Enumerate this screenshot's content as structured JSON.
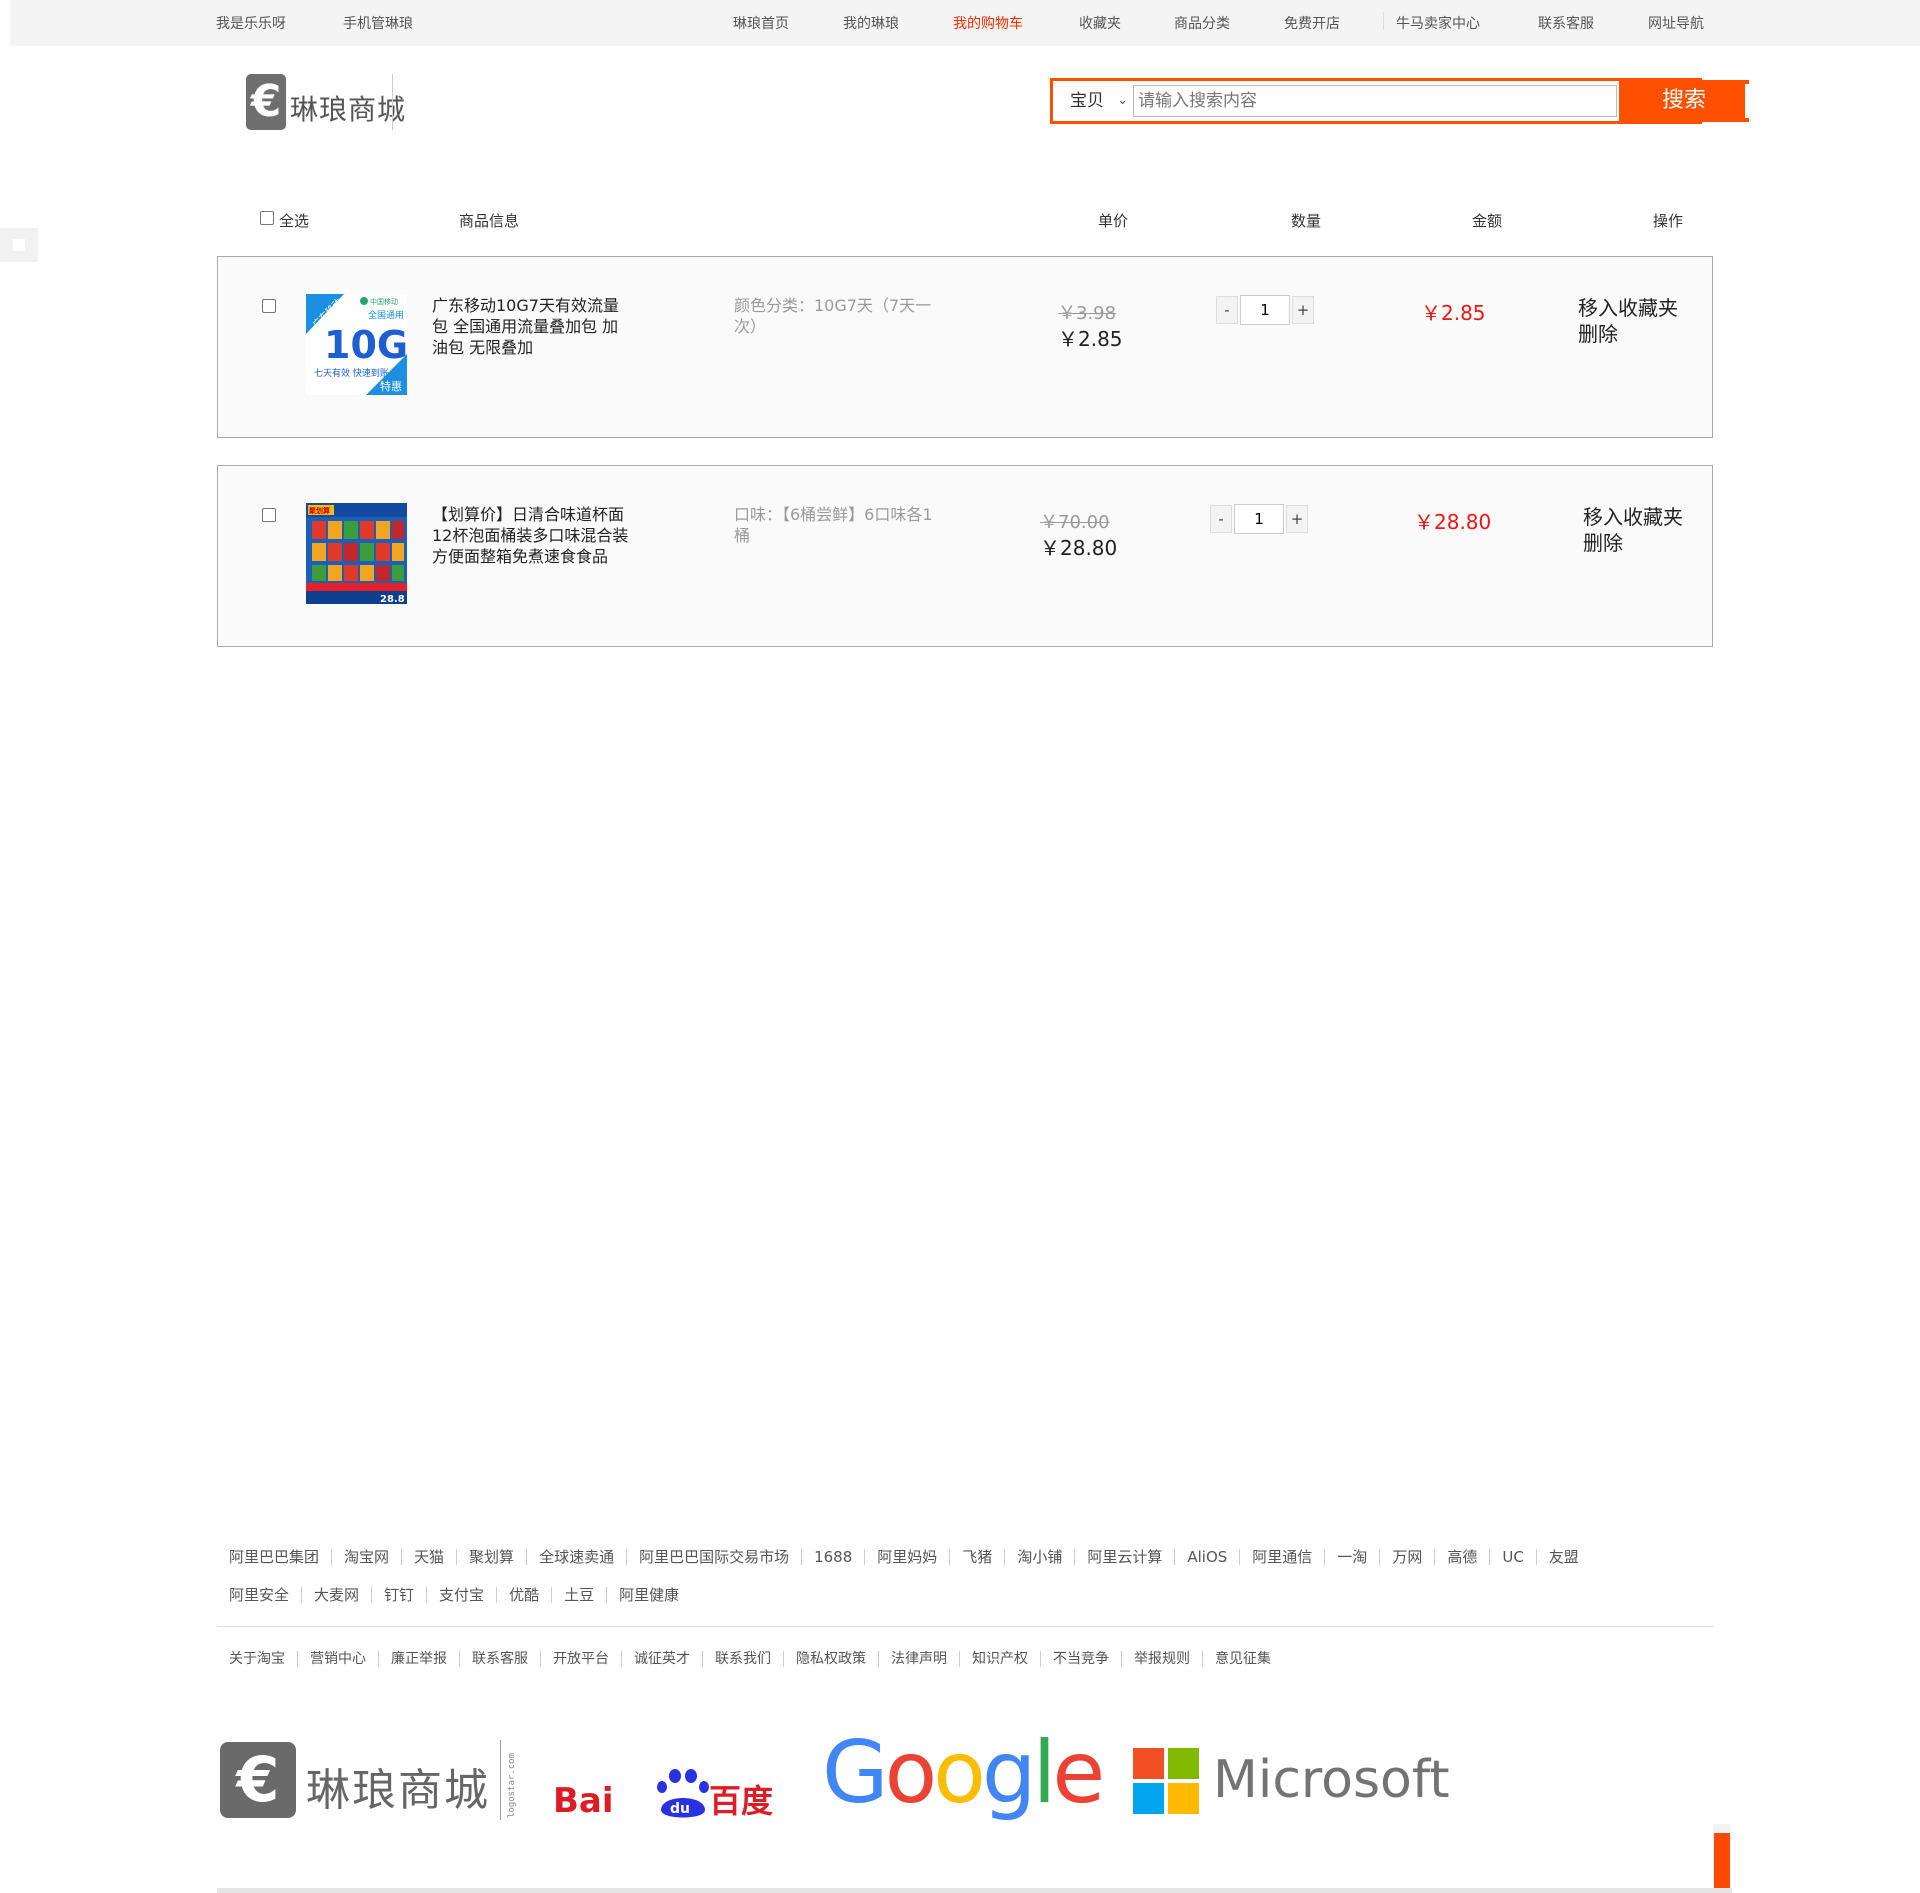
{
  "topnav": {
    "user": "我是乐乐呀",
    "mobile": "手机管琳琅",
    "items": [
      "琳琅首页",
      "我的琳琅",
      "我的购物车",
      "收藏夹",
      "商品分类",
      "免费开店",
      "牛马卖家中心",
      "联系客服",
      "网址导航"
    ],
    "active_index": 2,
    "active_color": "#f22e00"
  },
  "header": {
    "logo_symbol": "€",
    "logo_text": "琳琅商城",
    "search": {
      "category": "宝贝",
      "placeholder": "请输入搜索内容",
      "button": "搜索",
      "accent": "#ff5000"
    }
  },
  "cart": {
    "columns": {
      "select_all": "全选",
      "info": "商品信息",
      "price": "单价",
      "qty": "数量",
      "total": "金额",
      "ops": "操作"
    },
    "items": [
      {
        "title": "广东移动10G7天有效流量包 全国通用流量叠加包 加油包 无限叠加",
        "attr": "颜色分类：10G7天（7天一次）",
        "old_price": "￥3.98",
        "price": "￥2.85",
        "qty": "1",
        "total": "￥2.85",
        "op_fav": "移入收藏夹",
        "op_del": "删除",
        "thumb": {
          "corner": "广东移动",
          "brand": "中国移动",
          "sub": "全国通用",
          "big": "10G",
          "slogan": "七天有效 快速到账",
          "tag": "特惠"
        }
      },
      {
        "title": "【划算价】日清合味道杯面12杯泡面桶装多口味混合装方便面整箱免煮速食食品",
        "attr": "口味：【6桶尝鲜】6口味各1桶",
        "old_price": "￥70.00",
        "price": "￥28.80",
        "qty": "1",
        "total": "￥28.80",
        "op_fav": "移入收藏夹",
        "op_del": "删除",
        "thumb": {
          "badge": "聚划算",
          "price": "28.8"
        }
      }
    ],
    "minus": "-",
    "plus": "+",
    "price_color": "#f01414"
  },
  "footer": {
    "links_row1": [
      "阿里巴巴集团",
      "淘宝网",
      "天猫",
      "聚划算",
      "全球速卖通",
      "阿里巴巴国际交易市场",
      "1688",
      "阿里妈妈",
      "飞猪",
      "淘小铺",
      "阿里云计算",
      "AliOS",
      "阿里通信",
      "一淘",
      "万网",
      "高德",
      "UC",
      "友盟"
    ],
    "links_row2": [
      "阿里安全",
      "大麦网",
      "钉钉",
      "支付宝",
      "优酷",
      "土豆",
      "阿里健康"
    ],
    "links_row3": [
      "关于淘宝",
      "营销中心",
      "廉正举报",
      "联系客服",
      "开放平台",
      "诚征英才",
      "联系我们",
      "隐私权政策",
      "法律声明",
      "知识产权",
      "不当竞争",
      "举报规则",
      "意见征集"
    ],
    "logos": {
      "linlang": "琳琅商城",
      "linlang_symbol": "€",
      "linlang_vertical": "logostar.com",
      "baidu_a": "Bai",
      "baidu_paw": "du",
      "baidu_b": "百度",
      "google": [
        "G",
        "o",
        "o",
        "g",
        "l",
        "e"
      ],
      "microsoft": "Microsoft"
    }
  }
}
